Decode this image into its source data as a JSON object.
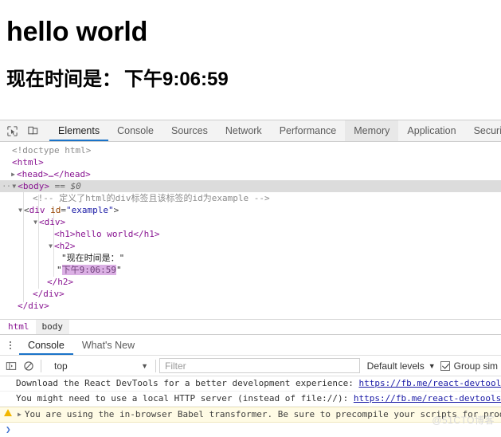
{
  "page": {
    "heading": "hello world",
    "time_label": "现在时间是：",
    "time_value": "下午9:06:59"
  },
  "devtools": {
    "icons": {
      "inspect": "inspect-element-icon",
      "device": "device-toolbar-icon"
    },
    "tabs": [
      {
        "label": "Elements",
        "state": "active"
      },
      {
        "label": "Console",
        "state": "normal"
      },
      {
        "label": "Sources",
        "state": "normal"
      },
      {
        "label": "Network",
        "state": "normal"
      },
      {
        "label": "Performance",
        "state": "normal"
      },
      {
        "label": "Memory",
        "state": "hovered"
      },
      {
        "label": "Application",
        "state": "normal"
      },
      {
        "label": "Security",
        "state": "normal"
      }
    ],
    "accent_color": "#1a73c8"
  },
  "dom": {
    "lines": [
      {
        "doctype": "<!doctype html>"
      },
      {
        "open_html": "<html>"
      },
      {
        "head": "<head>…</head>"
      },
      {
        "body": "<body>",
        "marker": "== $0"
      },
      {
        "comment": "<!-- 定义了html的div标签且该标签的id为example -->"
      },
      {
        "div_example_tag": "div",
        "div_example_attr": "id",
        "div_example_val": "\"example\""
      },
      {
        "div_tag": "<div>"
      },
      {
        "h1": "<h1>hello world</h1>"
      },
      {
        "h2_open": "<h2>"
      },
      {
        "text1": "\"现在时间是：\""
      },
      {
        "text2_quote_open": "\"",
        "text2_value": "下午9:06:59",
        "text2_quote_close": "\""
      },
      {
        "h2_close": "</h2>"
      },
      {
        "div_close": "</div>"
      },
      {
        "div_example_close": "</div>"
      }
    ],
    "highlight_color": "#dbb0e4"
  },
  "breadcrumb": {
    "items": [
      {
        "label": "html",
        "selected": false
      },
      {
        "label": "body",
        "selected": true
      }
    ]
  },
  "drawer": {
    "tabs": [
      {
        "label": "Console",
        "state": "active"
      },
      {
        "label": "What's New",
        "state": "normal"
      }
    ]
  },
  "console_toolbar": {
    "sidebar_icon": "console-sidebar-icon",
    "clear_icon": "clear-console-icon",
    "context": "top",
    "context_arrow": "▼",
    "filter_placeholder": "Filter",
    "levels_label": "Default levels",
    "levels_arrow": "▼",
    "group_similar_label": "Group sim",
    "group_similar_checked": true
  },
  "console_messages": [
    {
      "type": "info",
      "text": "Download the React DevTools for a better development experience: ",
      "link": "https://fb.me/react-devtools"
    },
    {
      "type": "info",
      "text": "You might need to use a local HTTP server (instead of file://): ",
      "link": "https://fb.me/react-devtools-"
    },
    {
      "type": "warning",
      "icon": "warning-triangle-icon",
      "disclosure": "▶",
      "text": "You are using the in-browser Babel transformer. Be sure to precompile your scripts for prod"
    }
  ],
  "prompt": {
    "chevron": "❯"
  },
  "watermark": {
    "text": "@51CTO博客"
  }
}
